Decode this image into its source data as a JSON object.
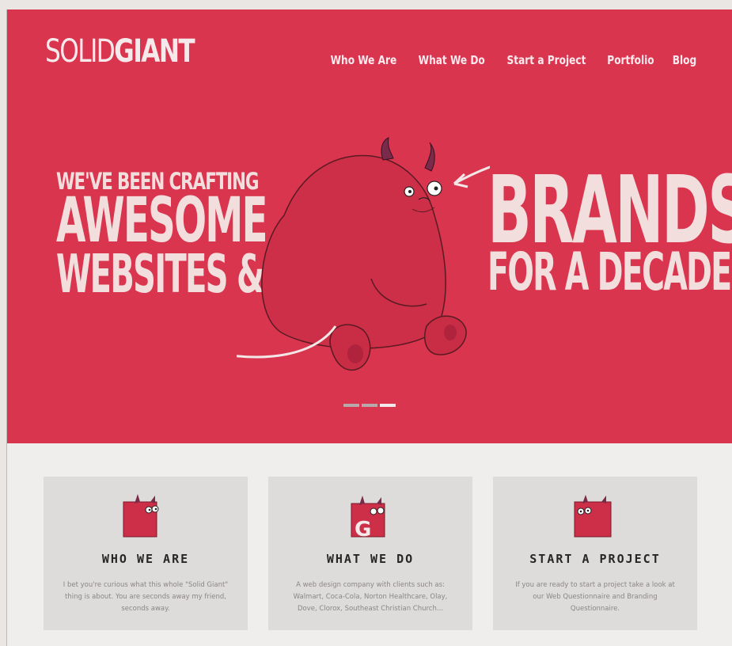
{
  "logo": {
    "part1": "SOLID",
    "part2": "GIANT"
  },
  "nav": [
    "Who We Are",
    "What We Do",
    "Start a Project",
    "Portfolio",
    "Blog"
  ],
  "hero": {
    "left_line1": "WE'VE BEEN CRAFTING",
    "left_line2": "AWESOME",
    "left_line3": "WEBSITES &",
    "right_line1": "BRANDS",
    "right_line2": "FOR A DECADE!",
    "slides_total": 3,
    "slide_active": 3
  },
  "colors": {
    "hero_bg": "#d9354f",
    "hero_text": "#f3dede",
    "card_bg": "#dedcda"
  },
  "cards": [
    {
      "title": "WHO WE ARE",
      "text": "I bet you're curious what this whole \"Solid Giant\" thing is about. You are seconds away my friend, seconds away.",
      "icon": "monster-icon"
    },
    {
      "title": "WHAT WE DO",
      "text": "A web design company with clients such as: Walmart, Coca-Cola, Norton Healthcare, Olay, Dove, Clorox, Southeast Christian Church...",
      "icon": "monster-g-icon"
    },
    {
      "title": "START A PROJECT",
      "text": "If you are ready to start a project take a look at our Web Questionnaire and Branding Questionnaire.",
      "icon": "monster-icon"
    }
  ]
}
